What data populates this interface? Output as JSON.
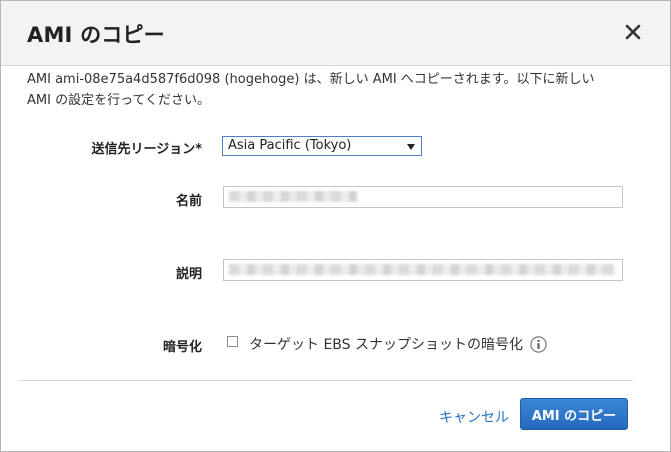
{
  "dialog": {
    "title": "AMI のコピー",
    "description_line1": "AMI ami-08e75a4d587f6d098 (hogehoge) は、新しい AMI へコピーされます。以下に新しい",
    "description_line2": "AMI の設定を行ってください。"
  },
  "form": {
    "region_label": "送信先リージョン*",
    "region_value": "Asia Pacific (Tokyo)",
    "name_label": "名前",
    "description_label": "説明",
    "encrypt_label": "暗号化",
    "encrypt_checkbox_label": "ターゲット EBS スナップショットの暗号化",
    "encrypt_checked": false
  },
  "footer": {
    "cancel_label": "キャンセル",
    "copy_label": "AMI のコピー"
  },
  "colors": {
    "accent": "#2c73c5",
    "primary_button": "#2a70c5",
    "header_bg": "#f3f3f3"
  },
  "icons": {
    "close": "close-icon",
    "dropdown": "chevron-down-icon",
    "info": "info-icon"
  }
}
